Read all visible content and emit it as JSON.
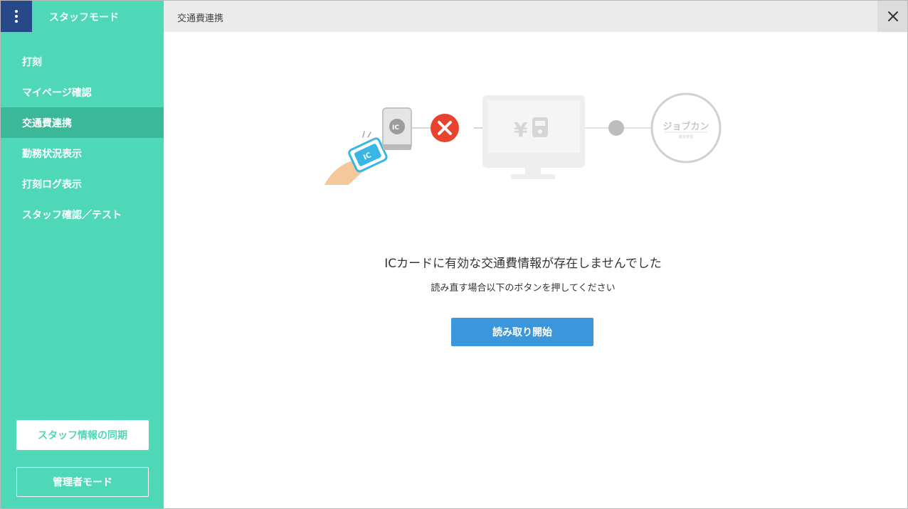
{
  "sidebar": {
    "mode_title": "スタッフモード",
    "items": [
      {
        "label": "打刻"
      },
      {
        "label": "マイページ確認"
      },
      {
        "label": "交通費連携",
        "active": true
      },
      {
        "label": "勤務状況表示"
      },
      {
        "label": "打刻ログ表示"
      },
      {
        "label": "スタッフ確認／テスト"
      }
    ],
    "sync_button": "スタッフ情報の同期",
    "admin_button": "管理者モード"
  },
  "header": {
    "title": "交通費連携",
    "close_icon": "close-icon"
  },
  "illustration": {
    "ic_label": "IC",
    "card_label": "IC",
    "monitor_symbol": "¥",
    "logo_text": "ジョブカン",
    "logo_sub": "勤怠管理",
    "status_icon": "error-x-icon"
  },
  "main": {
    "message": "ICカードに有効な交通費情報が存在しませんでした",
    "sub_message": "読み直す場合以下のボタンを押してください",
    "start_button": "読み取り開始"
  },
  "colors": {
    "sidebar_bg": "#4ed8b8",
    "sidebar_active": "#3bb898",
    "menu_button": "#27498a",
    "primary_button": "#3b96dc",
    "error": "#e8432e"
  }
}
